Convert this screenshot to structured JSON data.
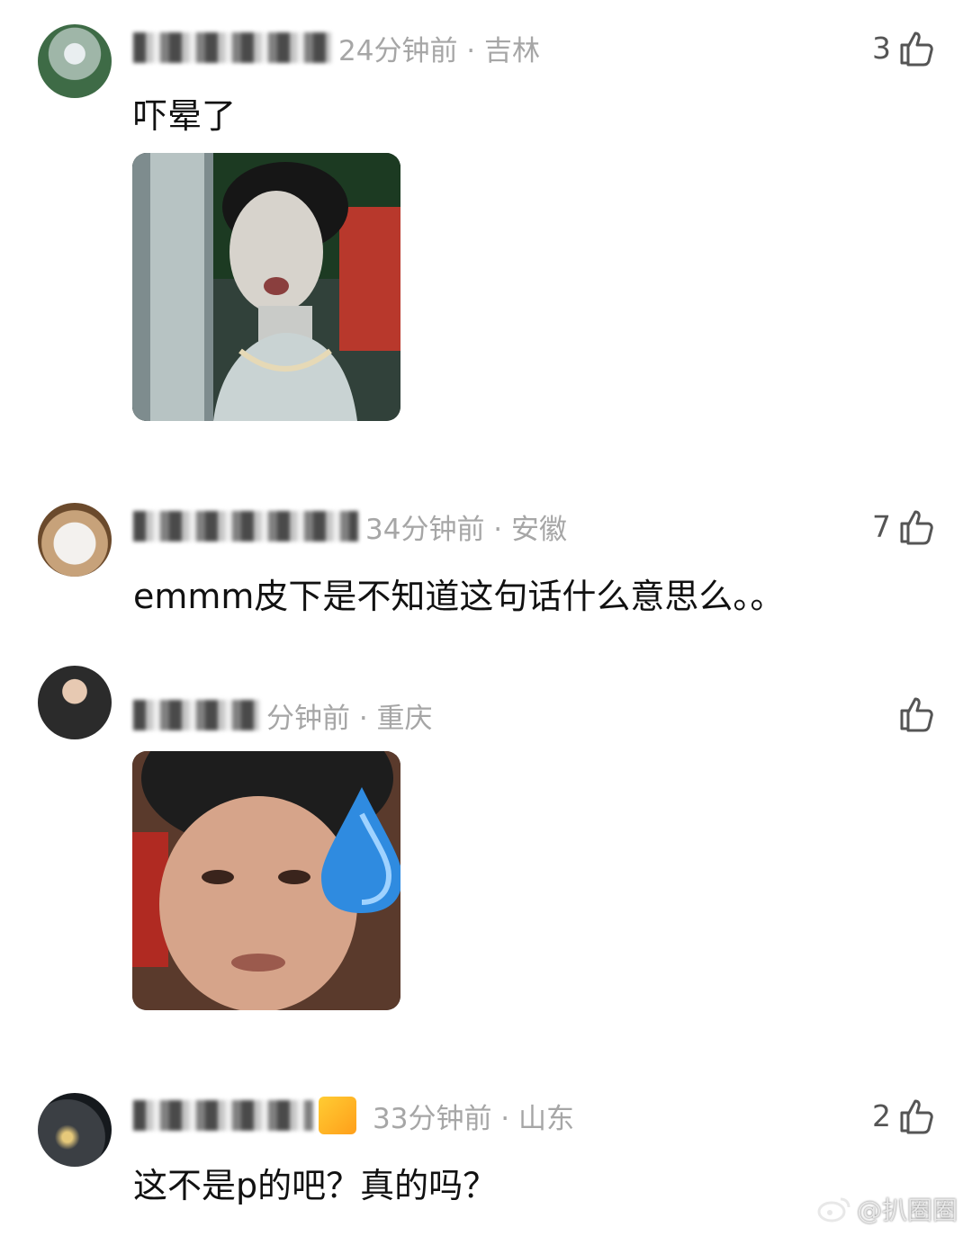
{
  "comments": [
    {
      "meta": "24分钟前 · 吉林",
      "likes": "3",
      "text": "吓晕了"
    },
    {
      "meta": "34分钟前 · 安徽",
      "likes": "7",
      "text": "emmm皮下是不知道这句话什么意思么。。"
    },
    {
      "meta": "分钟前 · 重庆",
      "likes": "",
      "text": ""
    },
    {
      "meta": "33分钟前 · 山东",
      "likes": "2",
      "text": "这不是p的吧？真的吗？"
    }
  ],
  "watermark": "@扒圈圈",
  "icons": {
    "like": "thumbs-up-icon",
    "weibo": "weibo-logo-icon",
    "badge": "fan-badge-icon"
  }
}
